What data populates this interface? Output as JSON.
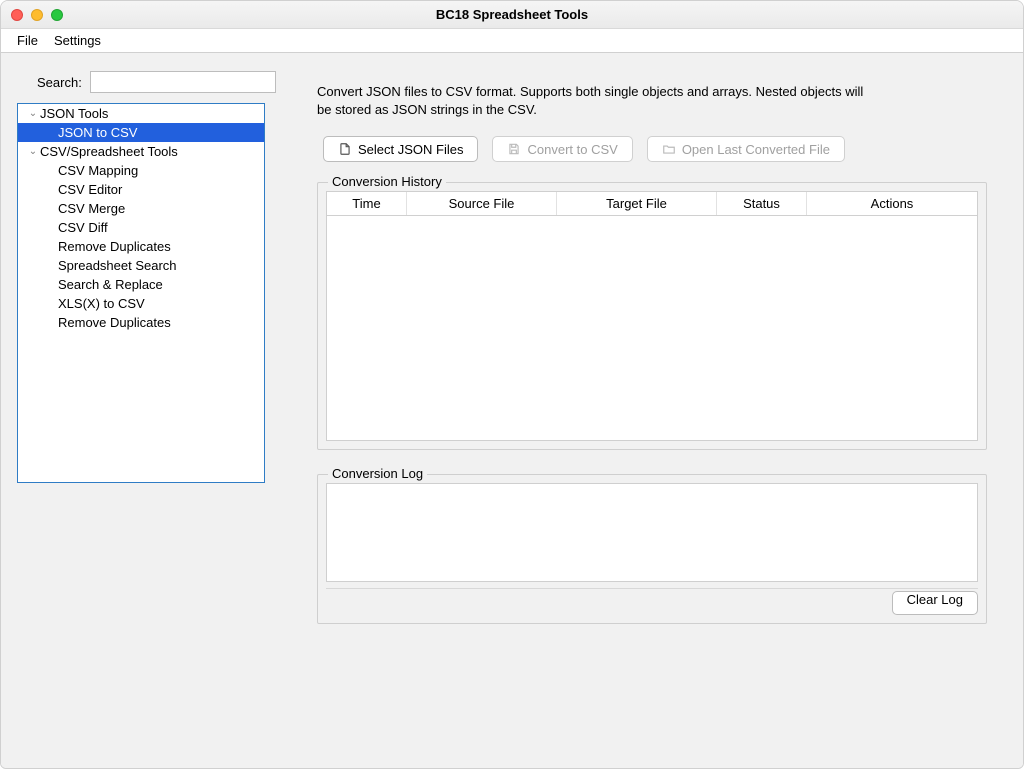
{
  "window_title": "BC18 Spreadsheet Tools",
  "menubar": {
    "file": "File",
    "settings": "Settings"
  },
  "sidebar": {
    "search_label": "Search:",
    "groups": [
      {
        "label": "JSON Tools",
        "items": [
          {
            "label": "JSON to CSV",
            "selected": true
          }
        ]
      },
      {
        "label": "CSV/Spreadsheet Tools",
        "items": [
          {
            "label": "CSV Mapping"
          },
          {
            "label": "CSV Editor"
          },
          {
            "label": "CSV Merge"
          },
          {
            "label": "CSV Diff"
          },
          {
            "label": "Remove Duplicates"
          },
          {
            "label": "Spreadsheet Search"
          },
          {
            "label": "Search & Replace"
          },
          {
            "label": "XLS(X) to CSV"
          },
          {
            "label": "Remove Duplicates"
          }
        ]
      }
    ]
  },
  "main": {
    "description": "Convert JSON files to CSV format. Supports both single objects and arrays. Nested objects will be stored as JSON strings in the CSV.",
    "buttons": {
      "select_files": "Select JSON Files",
      "convert": "Convert to CSV",
      "open_last": "Open Last Converted File"
    },
    "history": {
      "legend": "Conversion History",
      "columns": {
        "time": "Time",
        "source": "Source File",
        "target": "Target File",
        "status": "Status",
        "actions": "Actions"
      }
    },
    "log": {
      "legend": "Conversion Log",
      "clear": "Clear Log"
    }
  }
}
